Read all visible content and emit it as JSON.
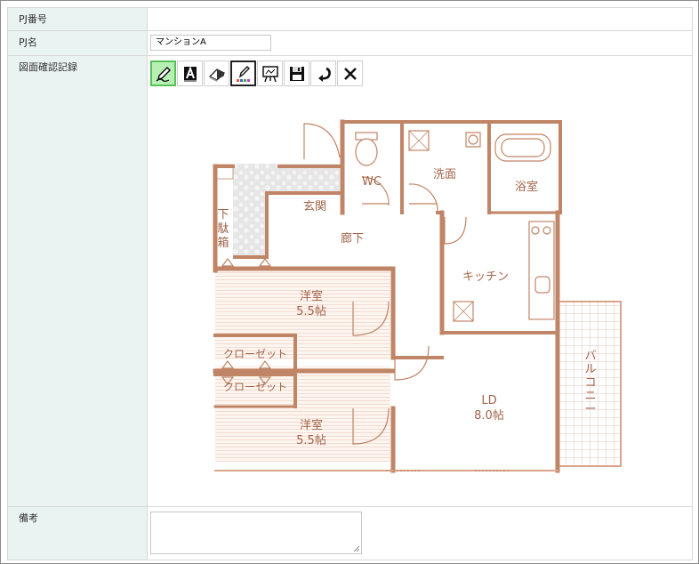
{
  "form": {
    "pj_number": {
      "label": "PJ番号",
      "value": ""
    },
    "pj_name": {
      "label": "PJ名",
      "value": "マンションA"
    },
    "drawing": {
      "label": "図面確認記録",
      "tools": [
        {
          "name": "pen-tool-button",
          "icon": "pen-icon"
        },
        {
          "name": "text-tool-button",
          "icon": "text-a-icon"
        },
        {
          "name": "eraser-tool-button",
          "icon": "eraser-icon"
        },
        {
          "name": "color-pen-button",
          "icon": "color-pen-icon"
        },
        {
          "name": "board-button",
          "icon": "easel-icon"
        },
        {
          "name": "save-button",
          "icon": "floppy-disk-icon"
        },
        {
          "name": "undo-button",
          "icon": "undo-arrow-icon"
        },
        {
          "name": "clear-button",
          "icon": "close-x-icon"
        }
      ],
      "floorplan": {
        "rooms": {
          "wc": "WC",
          "washroom": "洗面",
          "bathroom": "浴室",
          "entrance": "玄関",
          "shoe_box_1": "下",
          "shoe_box_2": "駄",
          "shoe_box_3": "箱",
          "hallway": "廊下",
          "kitchen": "キッチン",
          "western_room_1_name": "洋室",
          "western_room_1_size": "5.5帖",
          "closet_1": "クローゼット",
          "closet_2": "クローゼット",
          "western_room_2_name": "洋室",
          "western_room_2_size": "5.5帖",
          "ld_name": "LD",
          "ld_size": "8.0帖",
          "balcony_1": "バ",
          "balcony_2": "ル",
          "balcony_3": "コ",
          "balcony_4": "ニ",
          "balcony_5": "ー"
        }
      }
    },
    "remarks": {
      "label": "備考",
      "value": ""
    }
  },
  "colors": {
    "label_bg": "#e9f3f1",
    "wall": "#c08566",
    "room_text": "#a0644a",
    "active_tool": "#b8f0b4"
  }
}
